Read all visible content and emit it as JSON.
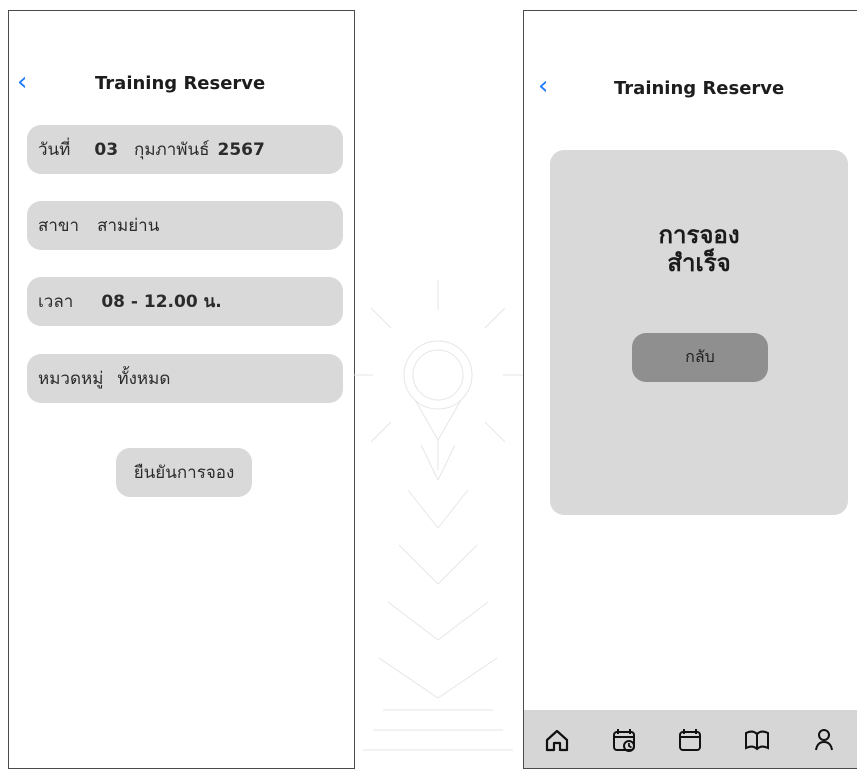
{
  "left_screen": {
    "title": "Training Reserve",
    "date": {
      "label": "วันที่",
      "day": "03",
      "month": "กุมภาพันธ์",
      "year": "2567"
    },
    "branch": {
      "label": "สาขา",
      "value": "สามย่าน"
    },
    "time": {
      "label": "เวลา",
      "value": "08 - 12.00 น."
    },
    "category": {
      "label": "หมวดหมู่",
      "value": "ทั้งหมด"
    },
    "confirm_button": "ยืนยันการจอง"
  },
  "right_screen": {
    "title": "Training Reserve",
    "success_message": "การจอง\nสำเร็จ",
    "back_button": "กลับ"
  },
  "bottom_nav": {
    "items": [
      {
        "icon": "home-icon"
      },
      {
        "icon": "calendar-clock-icon"
      },
      {
        "icon": "calendar-icon"
      },
      {
        "icon": "book-icon"
      },
      {
        "icon": "profile-icon"
      }
    ]
  }
}
